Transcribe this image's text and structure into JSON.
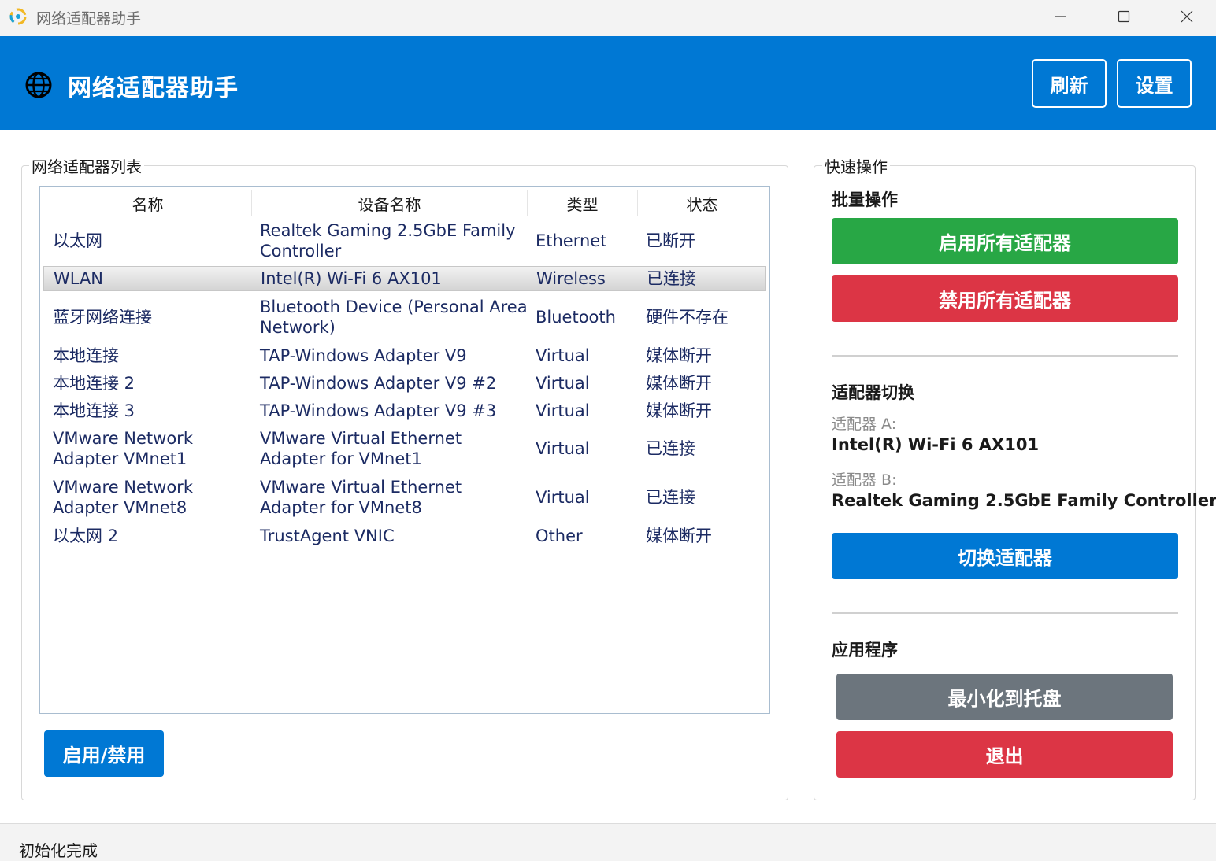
{
  "window": {
    "title": "网络适配器助手",
    "app_icon": "app-logo-icon",
    "controls": [
      "minimize-icon",
      "maximize-icon",
      "close-icon"
    ]
  },
  "header": {
    "title": "网络适配器助手",
    "icon": "globe-icon",
    "refresh_label": "刷新",
    "settings_label": "设置",
    "background_color": "#0078d4"
  },
  "adapter_list": {
    "group_label": "网络适配器列表",
    "columns": [
      "名称",
      "设备名称",
      "类型",
      "状态"
    ],
    "rows": [
      {
        "name": "以太网",
        "device": "Realtek Gaming 2.5GbE Family Controller",
        "type": "Ethernet",
        "status": "已断开"
      },
      {
        "name": "WLAN",
        "device": "Intel(R) Wi-Fi 6 AX101",
        "type": "Wireless",
        "status": "已连接",
        "selected": true
      },
      {
        "name": "蓝牙网络连接",
        "device": "Bluetooth Device (Personal Area Network)",
        "type": "Bluetooth",
        "status": "硬件不存在"
      },
      {
        "name": "本地连接",
        "device": "TAP-Windows Adapter V9",
        "type": "Virtual",
        "status": "媒体断开"
      },
      {
        "name": "本地连接 2",
        "device": "TAP-Windows Adapter V9 #2",
        "type": "Virtual",
        "status": "媒体断开"
      },
      {
        "name": "本地连接 3",
        "device": "TAP-Windows Adapter V9 #3",
        "type": "Virtual",
        "status": "媒体断开"
      },
      {
        "name": "VMware Network Adapter VMnet1",
        "device": "VMware Virtual Ethernet Adapter for VMnet1",
        "type": "Virtual",
        "status": "已连接"
      },
      {
        "name": "VMware Network Adapter VMnet8",
        "device": "VMware Virtual Ethernet Adapter for VMnet8",
        "type": "Virtual",
        "status": "已连接"
      },
      {
        "name": "以太网 2",
        "device": "TrustAgent VNIC",
        "type": "Other",
        "status": "媒体断开"
      }
    ],
    "toggle_label": "启用/禁用"
  },
  "quick_actions": {
    "group_label": "快速操作",
    "batch": {
      "title": "批量操作",
      "enable_all_label": "启用所有适配器",
      "disable_all_label": "禁用所有适配器",
      "enable_color": "#28a745",
      "disable_color": "#dc3545"
    },
    "switch": {
      "title": "适配器切换",
      "adapter_a_label": "适配器 A:",
      "adapter_a_value": "Intel(R) Wi-Fi 6 AX101",
      "adapter_b_label": "适配器 B:",
      "adapter_b_value": "Realtek Gaming 2.5GbE Family Controller",
      "switch_label": "切换适配器",
      "switch_color": "#0078d4"
    },
    "app": {
      "title": "应用程序",
      "minimize_label": "最小化到托盘",
      "exit_label": "退出",
      "minimize_color": "#6c757d",
      "exit_color": "#dc3545"
    }
  },
  "status_bar": {
    "text": "初始化完成"
  }
}
